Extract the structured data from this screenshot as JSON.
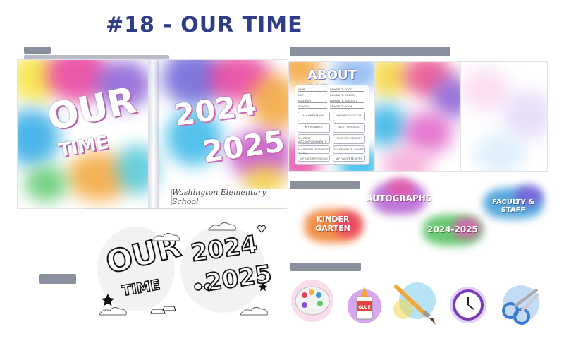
{
  "page": {
    "title": "#18 - OUR TIME"
  },
  "cover": {
    "front_title": "OUR TIME",
    "front_word1": "OUR",
    "front_word2": "TIME",
    "year_top": "2024",
    "year_bottom": "2025",
    "school_name": "Washington Elementary School"
  },
  "about_me": {
    "heading": "ABOUT ME",
    "fields": [
      "NAME",
      "FAVORITE FOOD",
      "AGE",
      "FAVORITE COLOR",
      "TEACHER",
      "FAVORITE SUBJECT",
      "SCHOOL",
      "FAVORITE BOOK"
    ],
    "boxes": [
      "MY DREAM JOB",
      "FAVORITE COLOR",
      "MY HOBBIES",
      "BEST FRIENDS",
      "MY BEST ACCOMPLISHMENTS",
      "FAVORITE MEMORY",
      "MY FAVORITE THINGS TO DO",
      "MY FAVORITE GAMES",
      "MY FAVORITE SONG",
      "MY FAVORITE APPS"
    ]
  },
  "stickers": {
    "items": [
      {
        "label": "AUTOGRAPHS"
      },
      {
        "label": "FACULTY & STAFF"
      },
      {
        "label": "KINDER GARTEN"
      },
      {
        "label": "2024-2025"
      }
    ]
  },
  "coloring": {
    "word1": "OUR",
    "word2": "TIME",
    "year_top": "2024",
    "year_bottom": "2025"
  },
  "clipart": {
    "items": [
      {
        "icon": "paint-palette-icon"
      },
      {
        "icon": "glue-bottle-icon",
        "label": "GLUE"
      },
      {
        "icon": "paintbrush-icon"
      },
      {
        "icon": "clock-icon"
      },
      {
        "icon": "scissors-icon"
      }
    ]
  },
  "colors": {
    "title": "#2f3c86",
    "section_header": "#8a8f9e",
    "pink": "#e83e9c",
    "purple": "#7b4fd1",
    "blue": "#2fa9e6",
    "yellow": "#f7d23a",
    "orange": "#f0822e",
    "green": "#5bc86a"
  }
}
